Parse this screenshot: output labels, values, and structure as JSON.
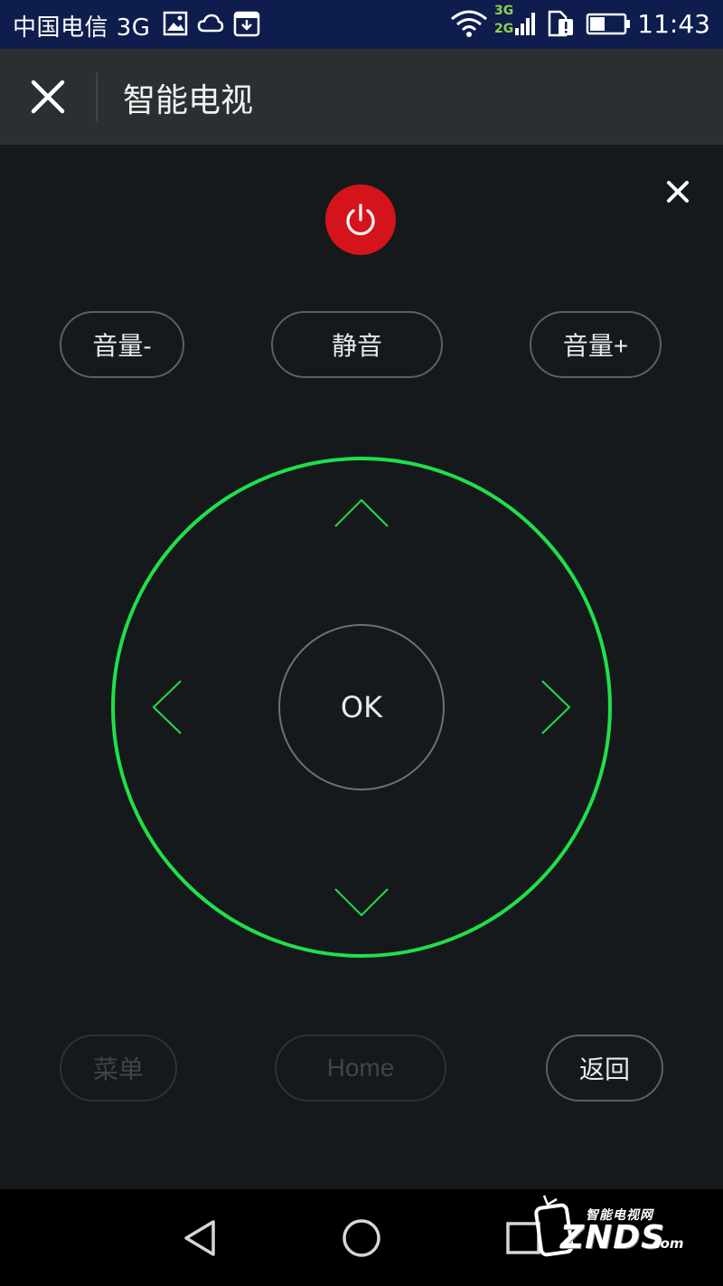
{
  "status_bar": {
    "carrier": "中国电信 3G",
    "network_label_top": "3G",
    "network_label_bottom": "2G",
    "time": "11:43",
    "icons": [
      "gallery-icon",
      "cloud-icon",
      "download-box-icon",
      "wifi-icon",
      "cell-signal-icon",
      "sim-alert-icon",
      "battery-icon"
    ]
  },
  "title_bar": {
    "title": "智能电视",
    "close_icon": "close-icon"
  },
  "remote": {
    "power_icon": "power-icon",
    "dismiss_icon": "close-icon",
    "volume_down": "音量-",
    "mute": "静音",
    "volume_up": "音量+",
    "ok": "OK",
    "menu": "菜单",
    "home": "Home",
    "back": "返回",
    "accent_color": "#1fe04a",
    "power_color": "#d4141a"
  },
  "nav_bar": {
    "icons": [
      "back-triangle-icon",
      "home-circle-icon",
      "recents-square-icon"
    ]
  },
  "watermark": {
    "subtitle": "智能电视网",
    "brand": "ZNDS",
    "suffix": ".com"
  }
}
